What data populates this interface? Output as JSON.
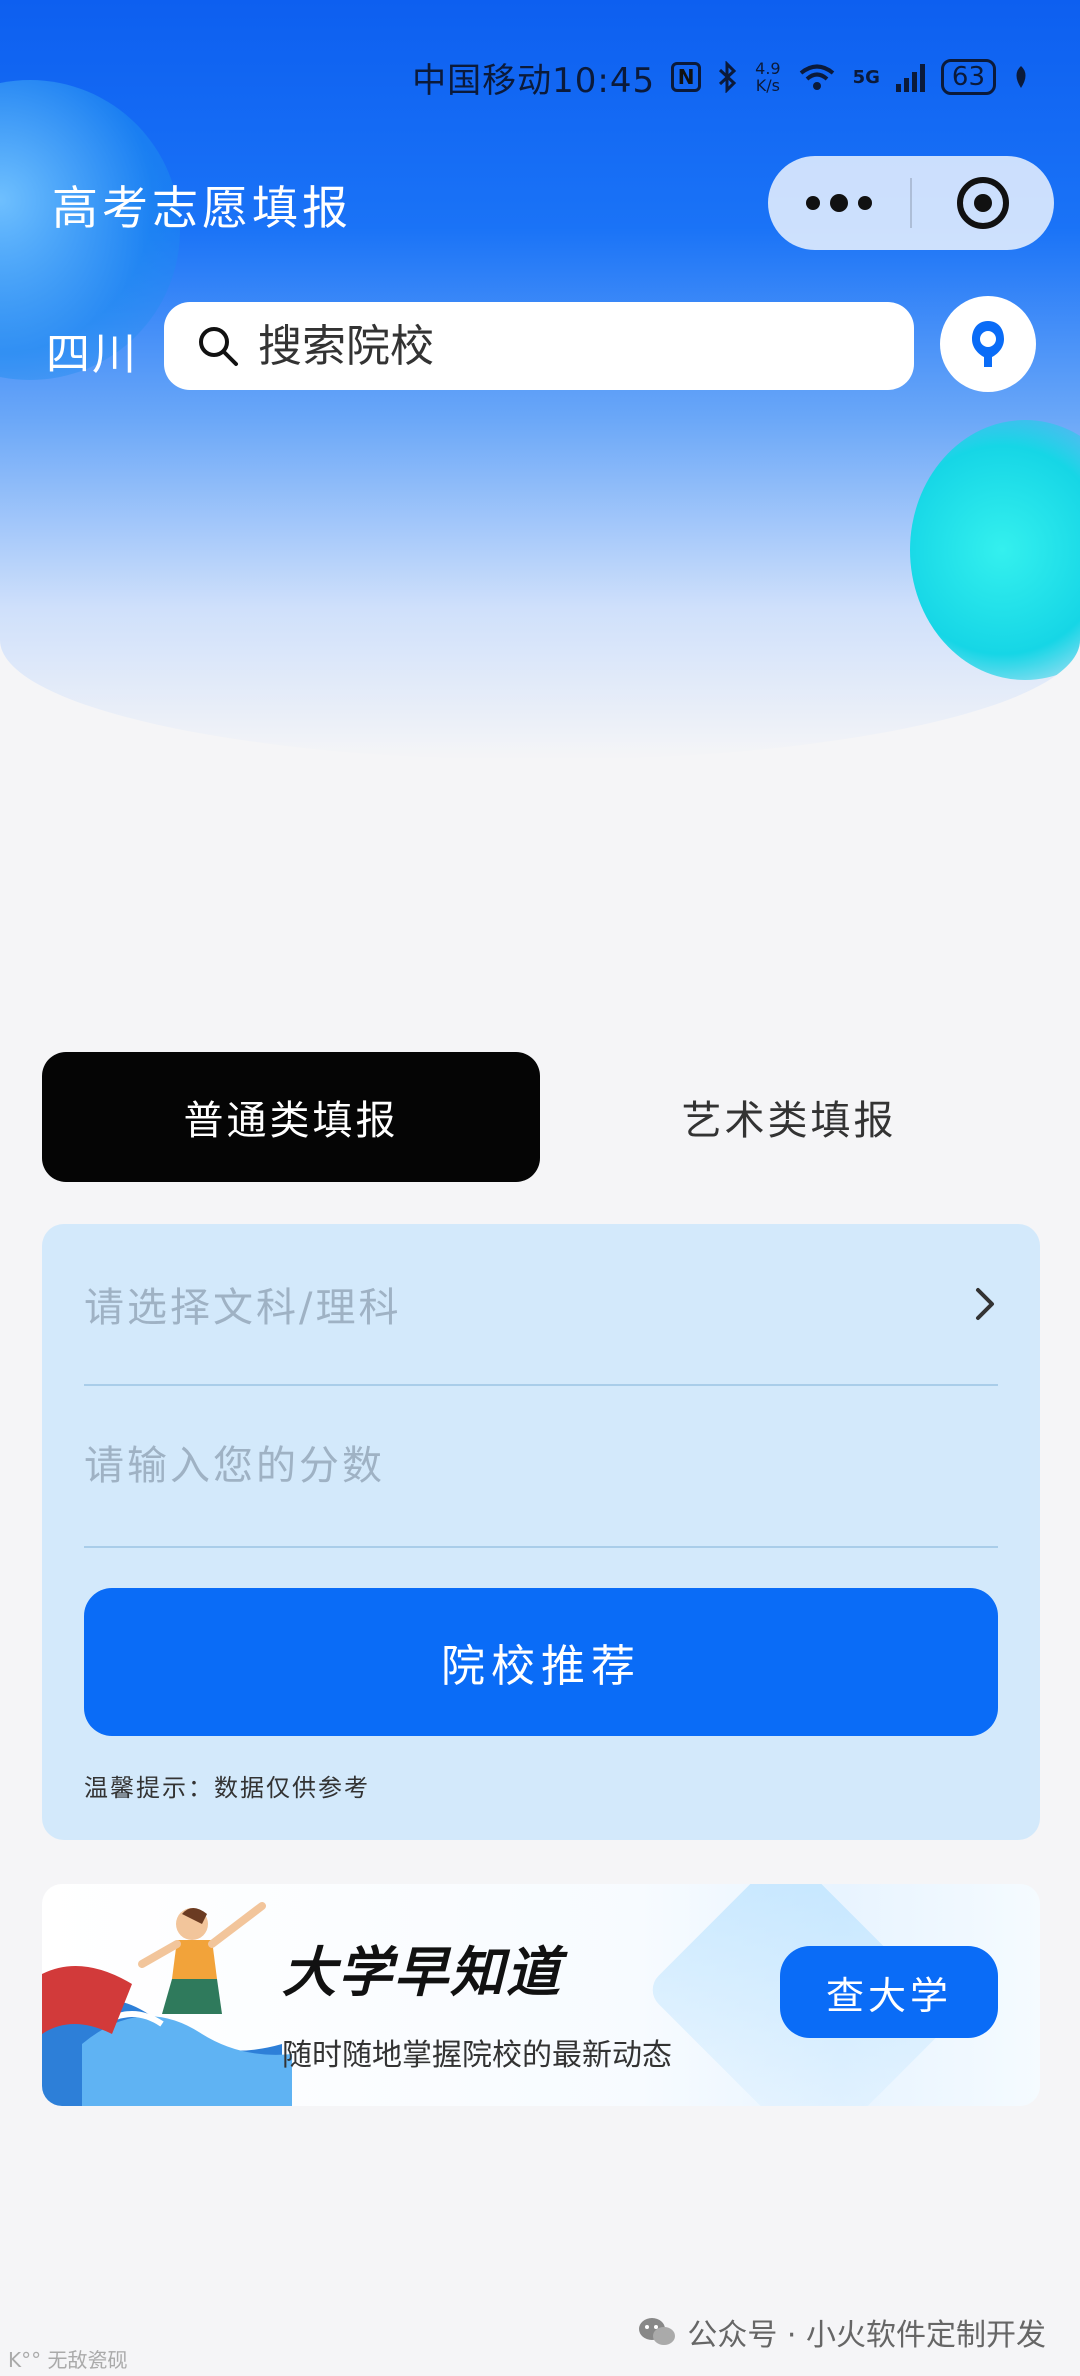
{
  "status_bar": {
    "carrier": "中国移动",
    "time": "10:45",
    "net_speed_value": "4.9",
    "net_speed_unit": "K/s",
    "network": "5G",
    "battery": "63",
    "icons": [
      "nfc-icon",
      "bluetooth-icon",
      "wifi-icon",
      "signal-icon",
      "battery-icon",
      "leaf-icon"
    ]
  },
  "header": {
    "title": "高考志愿填报",
    "region": "四川",
    "search_placeholder": "搜索院校",
    "capsule_icons": [
      "more-icon",
      "close-target-icon"
    ],
    "avatar_icon": "user-icon"
  },
  "tabs": [
    {
      "label": "普通类填报",
      "active": true
    },
    {
      "label": "艺术类填报",
      "active": false
    }
  ],
  "form": {
    "subject_placeholder": "请选择文科/理科",
    "score_placeholder": "请输入您的分数",
    "submit_label": "院校推荐",
    "tip": "温馨提示：数据仅供参考"
  },
  "banner": {
    "headline": "大学早知道",
    "subline": "随时随地掌握院校的最新动态",
    "button_label": "查大学"
  },
  "watermark": {
    "text": "公众号 · 小火软件定制开发",
    "corner": "K°° 无敌瓷砚"
  },
  "colors": {
    "primary": "#0a6cf7",
    "header_blue": "#0d5ff0",
    "card_bg": "#d3e9fb",
    "tab_active_bg": "#050505",
    "page_bg": "#f5f5f7"
  }
}
